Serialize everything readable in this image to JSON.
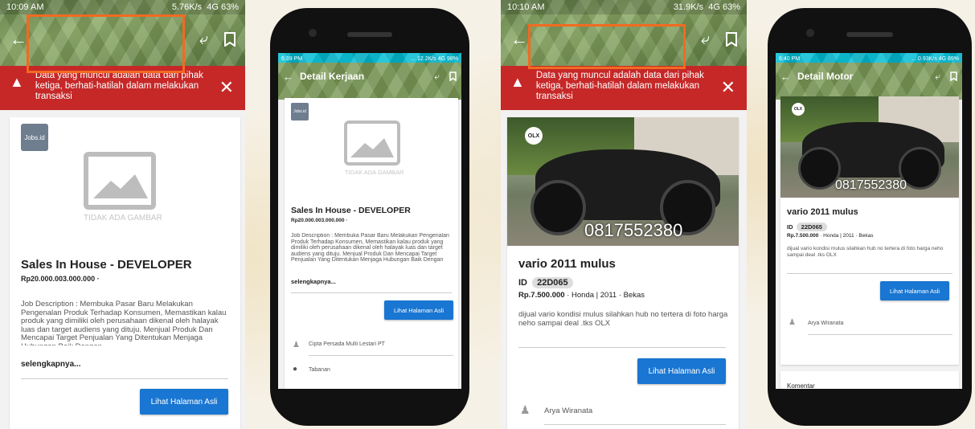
{
  "colors": {
    "accent": "#1976d2",
    "warning": "#c62828",
    "highlight": "#f26a21"
  },
  "s1": {
    "time": "10:09 AM",
    "net": "5.76K/s",
    "batt": "4G 63%",
    "warning": "Data yang muncul adalah data dari pihak ketiga, berhati-hatilah dalam melakukan transaksi",
    "no_image": "TIDAK ADA GAMBAR",
    "title": "Sales In House - DEVELOPER",
    "price": "Rp20.000.003.000.000 ·",
    "desc": "Job Description : Membuka Pasar Baru Melakukan Pengenalan Produk Terhadap Konsumen, Memastikan kalau produk yang dimiliki oleh perusahaan dikenal oleh halayak luas dan target audiens yang dituju. Menjual Produk Dan Mencapai Target Penjualan Yang Ditentukan Menjaga Hubungan Baik Dengan",
    "more": "selengkapnya...",
    "button": "Lihat Halaman Asli",
    "logo": "Jobs.id"
  },
  "s2": {
    "time": "6:39 PM",
    "net": "... 12.2K/s",
    "batt": "4G 98%",
    "title_bar": "Detail Kerjaan",
    "no_image": "TIDAK ADA GAMBAR",
    "title": "Sales In House - DEVELOPER",
    "price": "Rp20.000.003.000.000 ·",
    "desc": "Job Description : Membuka Pasar Baru Melakukan Pengenalan Produk Terhadap Konsumen, Memastikan kalau produk yang dimiliki oleh perusahaan dikenal oleh halayak luas dan target audiens yang dituju. Menjual Produk Dan Mencapai Target Penjualan Yang Ditentukan Menjaga Hubungan Baik Dengan",
    "more": "selengkapnya...",
    "button": "Lihat Halaman Asli",
    "company": "Cipta Persada Multi Lestari PT",
    "location": "Tabanan",
    "logo": "Jobs.id"
  },
  "s3": {
    "time": "10:10 AM",
    "net": "31.9K/s",
    "batt": "4G 63%",
    "warning": "Data yang muncul adalah data dari pihak ketiga, berhati-hatilah dalam melakukan transaksi",
    "phone": "0817552380",
    "olx": "OLX",
    "title": "vario 2011 mulus",
    "id_label": "ID",
    "id_value": "22D065",
    "price": "Rp.7.500.000",
    "meta": " · Honda | 2011 · Bekas",
    "desc": "dijual vario kondisi mulus silahkan hub no tertera di foto harga neho sampai deal .tks OLX",
    "button": "Lihat Halaman Asli",
    "seller": "Arya Wiranata"
  },
  "s4": {
    "time": "6:40 PM",
    "net": "... 0.93K/s",
    "batt": "4G 89%",
    "title_bar": "Detail Motor",
    "phone": "0817552380",
    "olx": "OLX",
    "title": "vario 2011 mulus",
    "id_label": "ID",
    "id_value": "22D065",
    "price": "Rp.7.500.000",
    "meta": " · Honda | 2011 · Bekas",
    "desc": "dijual vario kondisi mulus silahkan hub no tertera di foto harga neho sampai deal .tks OLX",
    "button": "Lihat Halaman Asli",
    "seller": "Arya Wiranata",
    "comments": "Komentar"
  }
}
